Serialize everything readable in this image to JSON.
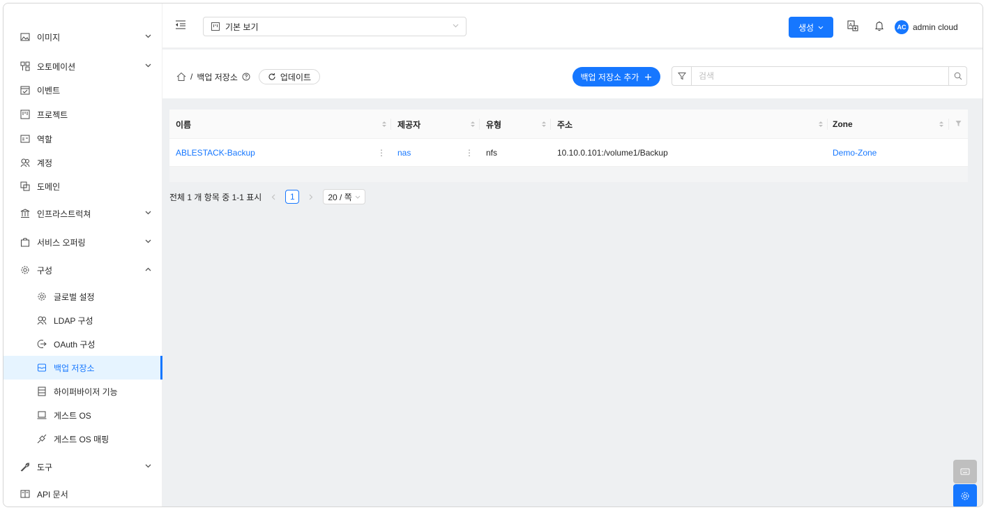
{
  "sidebar": {
    "items": [
      {
        "label": "이미지",
        "icon": "image-icon",
        "expandable": true,
        "expanded": false
      },
      {
        "label": "오토메이션",
        "icon": "apartment-icon",
        "expandable": true,
        "expanded": false
      },
      {
        "label": "이벤트",
        "icon": "schedule-icon",
        "expandable": false
      },
      {
        "label": "프로젝트",
        "icon": "project-icon",
        "expandable": false
      },
      {
        "label": "역할",
        "icon": "idcard-icon",
        "expandable": false
      },
      {
        "label": "계정",
        "icon": "team-icon",
        "expandable": false
      },
      {
        "label": "도메인",
        "icon": "block-icon",
        "expandable": false
      },
      {
        "label": "인프라스트럭쳐",
        "icon": "bank-icon",
        "expandable": true,
        "expanded": false
      },
      {
        "label": "서비스 오퍼링",
        "icon": "shopping-icon",
        "expandable": true,
        "expanded": false
      },
      {
        "label": "구성",
        "icon": "setting-icon",
        "expandable": true,
        "expanded": true
      },
      {
        "label": "글로벌 설정",
        "icon": "setting-icon",
        "sub": true
      },
      {
        "label": "LDAP 구성",
        "icon": "team-icon",
        "sub": true
      },
      {
        "label": "OAuth 구성",
        "icon": "login-icon",
        "sub": true
      },
      {
        "label": "백업 저장소",
        "icon": "inbox-icon",
        "sub": true,
        "active": true
      },
      {
        "label": "하이퍼바이저 기능",
        "icon": "database-icon",
        "sub": true
      },
      {
        "label": "게스트 OS",
        "icon": "laptop-icon",
        "sub": true
      },
      {
        "label": "게스트 OS 매핑",
        "icon": "api-icon",
        "sub": true
      },
      {
        "label": "도구",
        "icon": "tool-icon",
        "expandable": true,
        "expanded": false
      },
      {
        "label": "API 문서",
        "icon": "read-icon",
        "expandable": false
      }
    ]
  },
  "header": {
    "view_select": "기본 보기",
    "create_label": "생성",
    "user_initials": "AC",
    "user_name": "admin cloud"
  },
  "toolbar": {
    "breadcrumb_home_icon": "home-icon",
    "breadcrumb_separator": "/",
    "page_title": "백업 저장소",
    "refresh_label": "업데이트",
    "add_label": "백업 저장소 추가",
    "search_placeholder": "검색"
  },
  "table": {
    "columns": [
      "이름",
      "제공자",
      "유형",
      "주소",
      "Zone"
    ],
    "rows": [
      {
        "name": "ABLESTACK-Backup",
        "provider": "nas",
        "type": "nfs",
        "address": "10.10.0.101:/volume1/Backup",
        "zone": "Demo-Zone"
      }
    ]
  },
  "pagination": {
    "summary": "전체 1 개 항목 중 1-1 표시",
    "current_page": "1",
    "page_size": "20 / 쪽"
  },
  "colors": {
    "accent": "#1677ff",
    "float_grey": "#bfbfbf"
  }
}
